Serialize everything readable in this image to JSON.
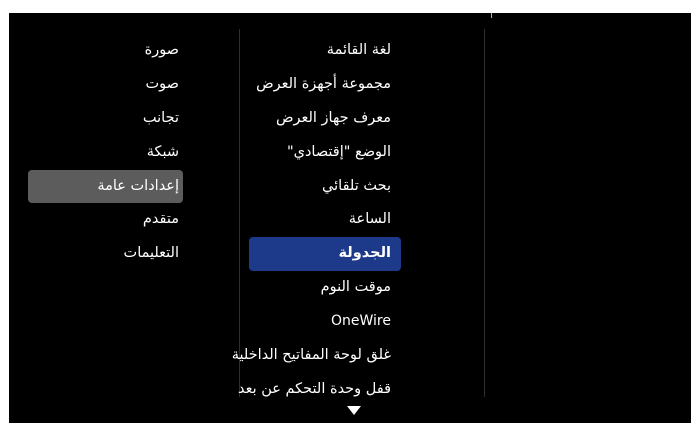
{
  "sidebar": {
    "items": [
      {
        "label": "صورة"
      },
      {
        "label": "صوت"
      },
      {
        "label": "تجانب"
      },
      {
        "label": "شبكة"
      },
      {
        "label": "إعدادات عامة",
        "selected": true
      },
      {
        "label": "متقدم"
      },
      {
        "label": "التعليمات"
      }
    ]
  },
  "submenu": {
    "items": [
      {
        "label": "لغة القائمة"
      },
      {
        "label": "مجموعة أجهزة العرض"
      },
      {
        "label": "معرف جهاز العرض"
      },
      {
        "label": "الوضع \"إقتصادي\""
      },
      {
        "label": "بحث تلقائي"
      },
      {
        "label": "الساعة"
      },
      {
        "label": "الجدولة",
        "selected": true
      },
      {
        "label": "موقت النوم"
      },
      {
        "label": "OneWire"
      },
      {
        "label": "غلق لوحة المفاتيح الداخلية"
      },
      {
        "label": "قفل وحدة التحكم عن بعد"
      }
    ],
    "more_icon": "chevron-down-icon"
  },
  "colors": {
    "background": "#000000",
    "text": "#ffffff",
    "sidebar_selected": "#5c5c5c",
    "submenu_selected": "#1d3a8a"
  }
}
